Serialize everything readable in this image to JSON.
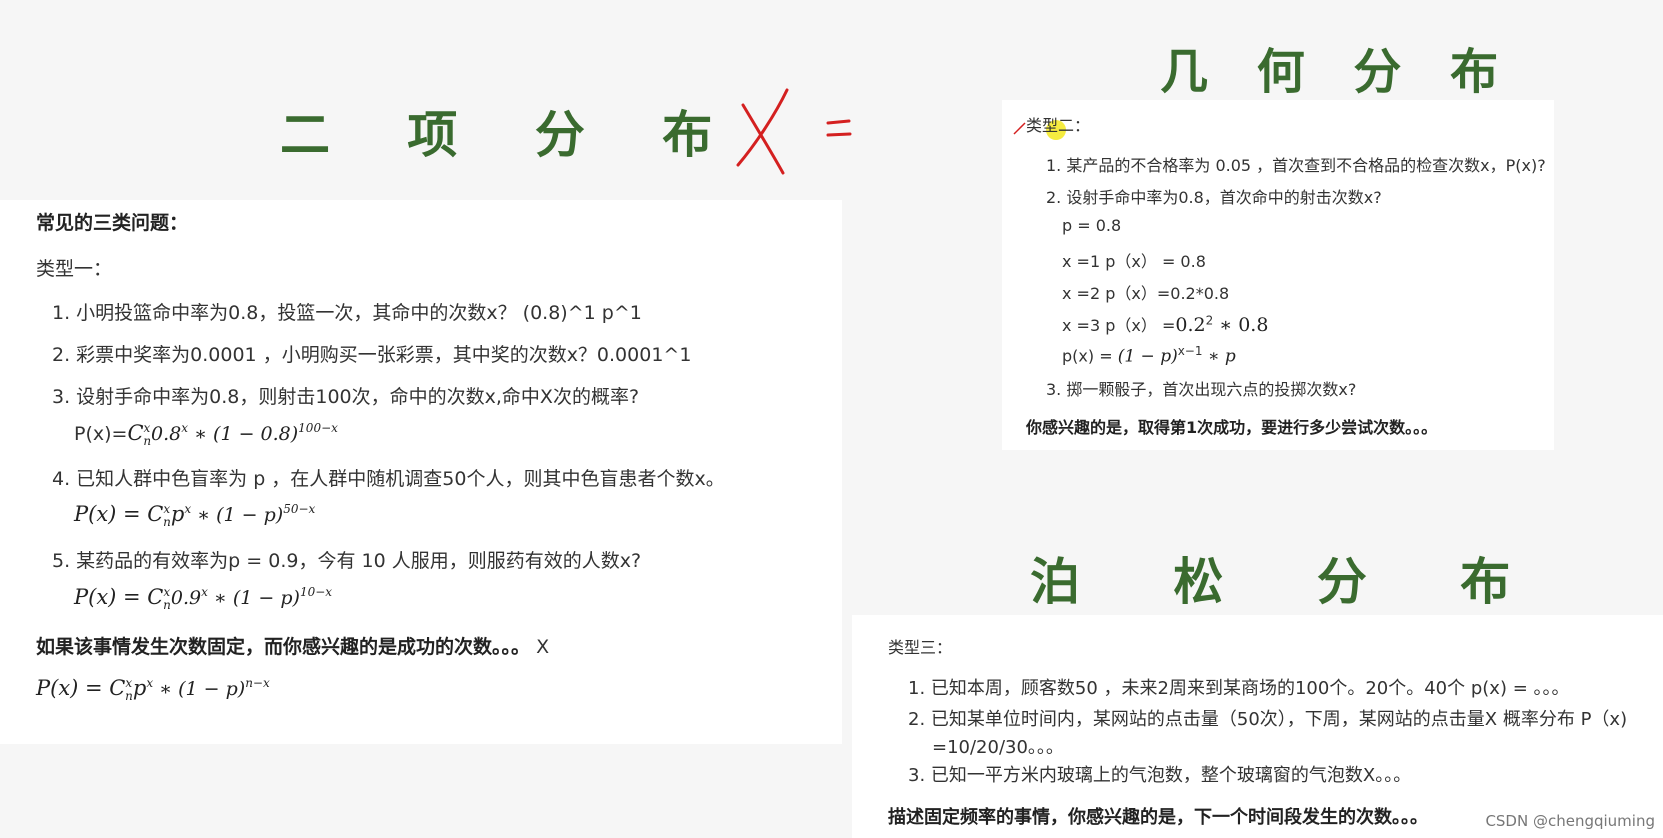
{
  "titles": {
    "binomial": "二 项 分 布",
    "geometric": "几 何 分 布",
    "poisson": "泊 松 分 布"
  },
  "handwriting": {
    "lhs": "X",
    "eq": "="
  },
  "binomial": {
    "heading": "常见的三类问题：",
    "type_label": "类型一：",
    "items": [
      "1. 小明投篮命中率为0.8，投篮一次，其命中的次数x？ (0.8)^1  p^1",
      "2. 彩票中奖率为0.0001 ，小明购买一张彩票，其中奖的次数x？0.0001^1",
      "3. 设射手命中率为0.8，则射击100次，命中的次数x,命中X次的概率?",
      "4. 已知人群中色盲率为 p ，在人群中随机调查50个人，则其中色盲患者个数x。",
      "5. 某药品的有效率为p = 0.9，今有 10 人服用，则服药有效的人数x?"
    ],
    "formula3_prefix": "P(x)=",
    "formula3_body": "C",
    "formula3_sup": "x",
    "formula3_sub": "n",
    "formula3_rest": "0.8",
    "formula3_rest_sup": "x",
    "formula3_tail": " ∗ (1 − 0.8)",
    "formula3_tail_sup": "100−x",
    "formula4_lhs": "P(x) = C",
    "formula4_sup": "x",
    "formula4_sub": "n",
    "formula4_mid": "p",
    "formula4_mid_sup": "x",
    "formula4_tail": " ∗ (1 − p)",
    "formula4_tail_sup": "50−x",
    "formula5_lhs": "P(x) = C",
    "formula5_sup": "x",
    "formula5_sub": "n",
    "formula5_mid": "0.9",
    "formula5_mid_sup": "x",
    "formula5_tail": " ∗ (1 − p)",
    "formula5_tail_sup": "10−x",
    "summary": "如果该事情发生次数固定，而你感兴趣的是成功的次数。。。",
    "summary_x": "X",
    "general_lhs": "P(x) = C",
    "general_sup": "x",
    "general_sub": "n",
    "general_mid": "p",
    "general_mid_sup": "x",
    "general_tail": " ∗ (1 − p)",
    "general_tail_sup": "n−x"
  },
  "geometric": {
    "type_label": "类型二：",
    "items": [
      "1. 某产品的不合格率为 0.05 ，首次查到不合格品的检查次数x，P(x)?",
      "2. 设射手命中率为0.8，首次命中的射击次数x?"
    ],
    "p_line": "p = 0.8",
    "x1": "x =1    p（x） = 0.8",
    "x2": "x =2    p（x）=0.2*0.8",
    "x3_prefix": "x =3   p（x） =",
    "x3_math": "0.2",
    "x3_sup": "2",
    "x3_tail": " ∗ 0.8",
    "px_prefix": "p(x) = ",
    "px_math": "(1 − p)",
    "px_sup": "x−1",
    "px_tail": " ∗ p",
    "item3": "3. 掷一颗骰子，首次出现六点的投掷次数x?",
    "summary": "你感兴趣的是，取得第1次成功，要进行多少尝试次数。。。"
  },
  "poisson": {
    "type_label": "类型三：",
    "items": [
      "1. 已知本周，顾客数50 ，未来2周来到某商场的100个。20个。40个 p(x) = 。。。",
      "2. 已知某单位时间内，某网站的点击量（50次），下周，某网站的点击量X 概率分布 P（x)",
      "=10/20/30。。。",
      "3. 已知一平方米内玻璃上的气泡数，整个玻璃窗的气泡数X。。。"
    ],
    "summary": "描述固定频率的事情，你感兴趣的是，下一个时间段发生的次数。。。"
  },
  "watermark": "CSDN @chengqiuming",
  "colors": {
    "title_green": "#3a6b2f",
    "ink_red": "#d42020",
    "highlight": "#f2e600"
  }
}
